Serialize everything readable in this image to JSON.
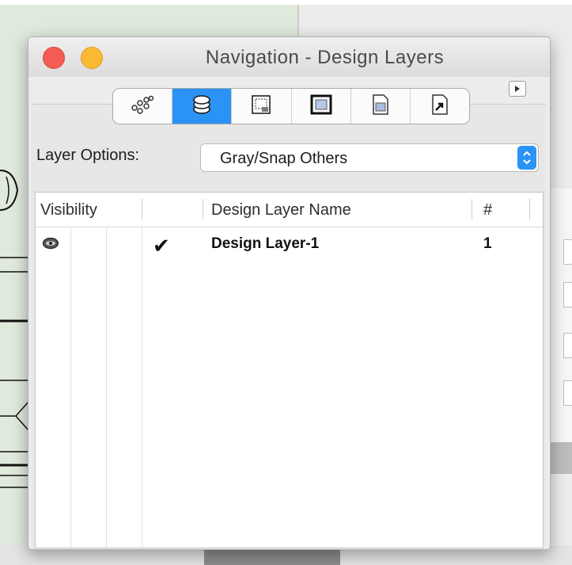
{
  "window": {
    "title": "Navigation - Design Layers"
  },
  "tabs": [
    {
      "icon": "class-hierarchy-icon"
    },
    {
      "icon": "design-layers-stack-icon",
      "active": true
    },
    {
      "icon": "sheet-layers-icon"
    },
    {
      "icon": "saved-views-icon"
    },
    {
      "icon": "referenced-file-icon"
    },
    {
      "icon": "symbol-link-icon"
    }
  ],
  "layer_options": {
    "label": "Layer Options:",
    "selected": "Gray/Snap Others"
  },
  "table": {
    "columns": [
      "Visibility",
      "",
      "Design Layer Name",
      "#"
    ],
    "rows": [
      {
        "visibility_icon": "eye-icon",
        "active_mark": "✔",
        "name": "Design Layer-1",
        "number": "1"
      }
    ]
  },
  "colors": {
    "accent": "#2a93f5",
    "close": "#f25c54",
    "minimize": "#fbb934"
  }
}
